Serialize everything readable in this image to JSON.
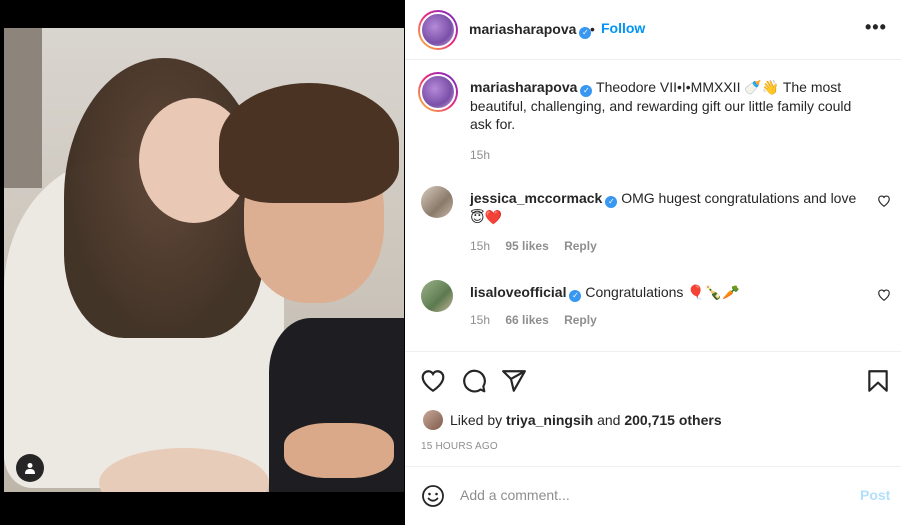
{
  "post": {
    "author": "mariasharapova",
    "header_dot": "•",
    "follow_label": "Follow",
    "more_label": "•••",
    "caption": {
      "username": "mariasharapova",
      "text": "Theodore VII•I•MMXXII 🍼👋 The most beautiful, challenging, and rewarding gift our little family could ask for.",
      "time": "15h"
    },
    "comments": [
      {
        "username": "jessica_mccormack",
        "text": "OMG hugest congratulations and love 😇❤️",
        "time": "15h",
        "likes": "95 likes",
        "reply_label": "Reply"
      },
      {
        "username": "lisaloveofficial",
        "text": "Congratulations 🎈🍾🥕",
        "time": "15h",
        "likes": "66 likes",
        "reply_label": "Reply"
      }
    ],
    "liked_by": {
      "prefix": "Liked by ",
      "user": "triya_ningsih",
      "middle": " and ",
      "others": "200,715 others"
    },
    "posted_time": "15 HOURS AGO",
    "add_comment": {
      "placeholder": "Add a comment...",
      "post_label": "Post"
    }
  },
  "colors": {
    "accent": "#0095f6",
    "verified": "#3897f0",
    "muted": "#8e8e8e",
    "post_disabled": "#b2dffc"
  },
  "icons": {
    "verified": "verified-badge-icon",
    "like": "heart-icon",
    "comment": "comment-bubble-icon",
    "share": "paper-plane-icon",
    "save": "bookmark-icon",
    "emoji": "smiley-icon",
    "tag": "user-tag-icon",
    "more": "more-options-icon"
  }
}
